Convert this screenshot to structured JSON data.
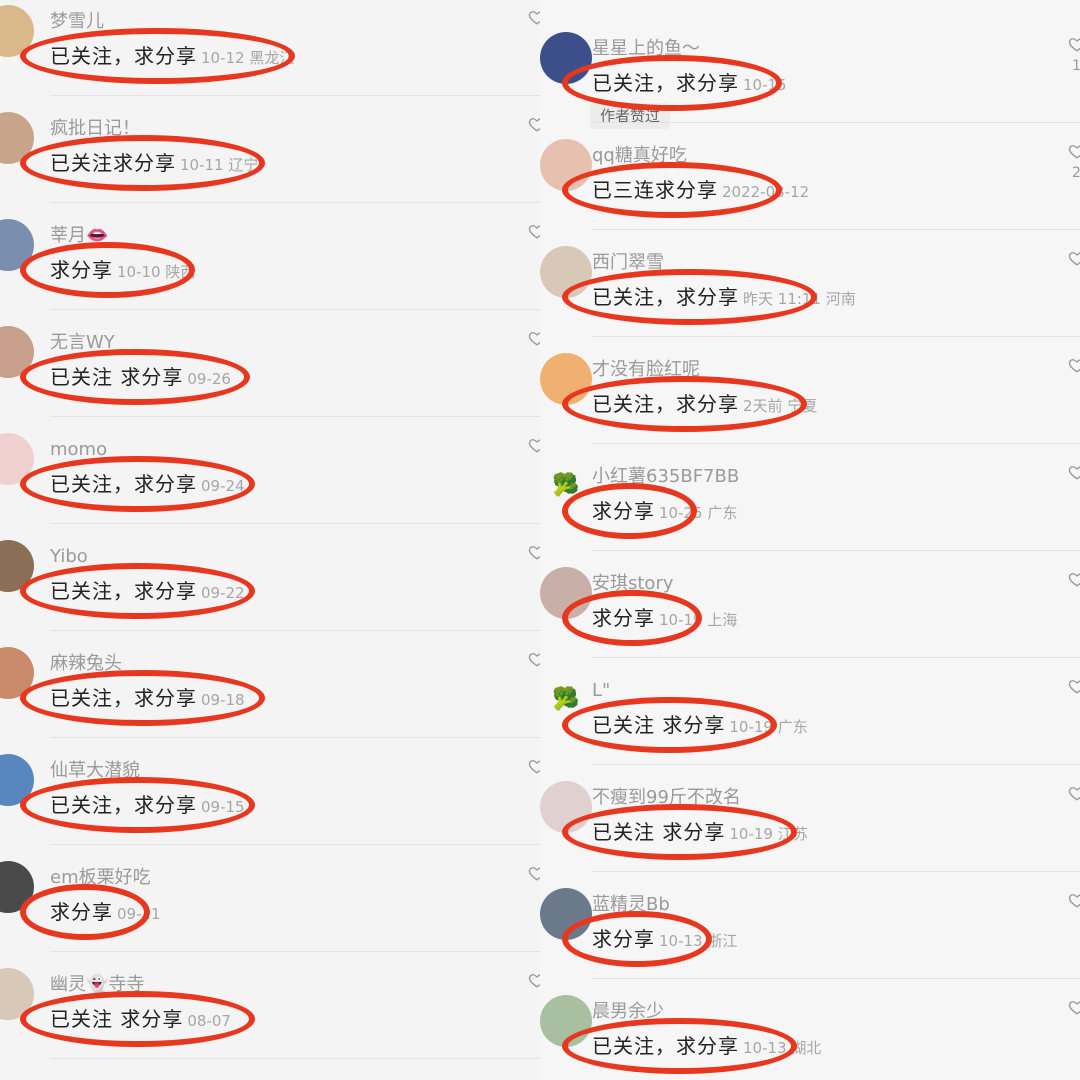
{
  "colors": {
    "annotation": "#e8371f",
    "username": "#9a9a9a",
    "comment": "#222222",
    "meta": "#a6a6a6",
    "background": "#f4f4f4"
  },
  "left_comments": [
    {
      "username": "梦雪儿",
      "comment": "已关注，求分享",
      "meta": "10-12 黑龙江",
      "avatar_icon": "user-avatar-photo"
    },
    {
      "username": "疯批日记！",
      "comment": "已关注求分享",
      "meta": "10-11 辽宁",
      "avatar_icon": "user-avatar-photo"
    },
    {
      "username": "莘月👄",
      "comment": "求分享",
      "meta": "10-10 陕西",
      "avatar_icon": "user-avatar-photo"
    },
    {
      "username": "无言WY",
      "comment": "已关注 求分享",
      "meta": "09-26",
      "avatar_icon": "user-avatar-photo"
    },
    {
      "username": "momo",
      "comment": "已关注，求分享",
      "meta": "09-24",
      "avatar_icon": "user-avatar-photo"
    },
    {
      "username": "Yibo",
      "comment": "已关注，求分享",
      "meta": "09-22",
      "avatar_icon": "user-avatar-photo"
    },
    {
      "username": "麻辣兔头",
      "comment": "已关注，求分享",
      "meta": "09-18",
      "avatar_icon": "user-avatar-photo"
    },
    {
      "username": "仙草大潜貌",
      "comment": "已关注，求分享",
      "meta": "09-15",
      "avatar_icon": "user-avatar-photo"
    },
    {
      "username": "em板栗好吃",
      "comment": "求分享",
      "meta": "09-11",
      "avatar_icon": "user-avatar-photo"
    },
    {
      "username": "幽灵👻寺寺",
      "comment": "已关注 求分享",
      "meta": "08-07",
      "avatar_icon": "user-avatar-photo"
    }
  ],
  "right_comments": [
    {
      "username": "星星上的鱼～",
      "comment": "已关注，求分享",
      "meta": "10-15",
      "avatar_icon": "user-avatar-photo",
      "badge": "作者赞过",
      "likes": "1"
    },
    {
      "username": "qq糖真好吃",
      "comment": "已三连求分享",
      "meta": "2022-03-12",
      "avatar_icon": "user-avatar-photo",
      "likes": "2"
    },
    {
      "username": "西门翠雪",
      "comment": "已关注，求分享",
      "meta": "昨天 11:11 河南",
      "avatar_icon": "user-avatar-photo"
    },
    {
      "username": "才没有脸红呢",
      "comment": "已关注，求分享",
      "meta": "2天前 宁夏",
      "avatar_icon": "user-avatar-photo"
    },
    {
      "username": "小红薯635BF7BB",
      "comment": "求分享",
      "meta": "10-25 广东",
      "avatar_icon": "broccoli-icon",
      "avatar_glyph": "🥦"
    },
    {
      "username": "安琪story",
      "comment": "求分享",
      "meta": "10-19 上海",
      "avatar_icon": "user-avatar-photo"
    },
    {
      "username": "L\"",
      "comment": "已关注 求分享",
      "meta": "10-19 广东",
      "avatar_icon": "broccoli-icon",
      "avatar_glyph": "🥦"
    },
    {
      "username": "不瘦到99斤不改名",
      "comment": "已关注 求分享",
      "meta": "10-19 江苏",
      "avatar_icon": "user-avatar-photo"
    },
    {
      "username": "蓝精灵Bb",
      "comment": "求分享",
      "meta": "10-13 浙江",
      "avatar_icon": "user-avatar-photo"
    },
    {
      "username": "晨男余少",
      "comment": "已关注，求分享",
      "meta": "10-13 湖北",
      "avatar_icon": "user-avatar-photo"
    }
  ]
}
